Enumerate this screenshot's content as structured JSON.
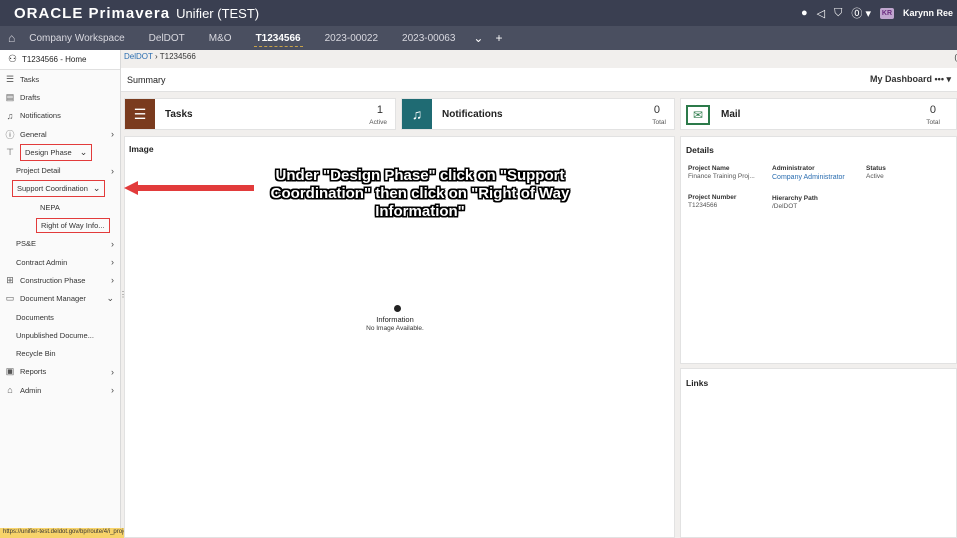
{
  "app": {
    "logo": "ORACLE Primavera",
    "title": "Unifier (TEST)",
    "user_initials": "KR",
    "user_name": "Karynn Ree"
  },
  "tabs": [
    "Company Workspace",
    "DelDOT",
    "M&O",
    "T1234566",
    "2023-00022",
    "2023-00063"
  ],
  "active_tab": "T1234566",
  "sidebar": {
    "home": "T1234566 - Home",
    "items": [
      {
        "label": "Tasks",
        "icon": "tasks-icon"
      },
      {
        "label": "Drafts",
        "icon": "drafts-icon"
      },
      {
        "label": "Notifications",
        "icon": "bell-icon"
      },
      {
        "label": "General",
        "icon": "info-icon"
      },
      {
        "label": "Design Phase",
        "icon": "design-icon"
      },
      {
        "label": "Project Detail"
      },
      {
        "label": "Support Coordination"
      },
      {
        "label": "NEPA"
      },
      {
        "label": "Right of Way Info..."
      },
      {
        "label": "PS&E"
      },
      {
        "label": "Contract Admin"
      },
      {
        "label": "Construction Phase",
        "icon": "construction-icon"
      },
      {
        "label": "Document Manager",
        "icon": "folder-icon"
      },
      {
        "label": "Documents"
      },
      {
        "label": "Unpublished Docume..."
      },
      {
        "label": "Recycle Bin"
      },
      {
        "label": "Reports",
        "icon": "reports-icon"
      },
      {
        "label": "Admin",
        "icon": "admin-icon"
      }
    ]
  },
  "status_url": "https://unifier-test.deldot.gov/bp/route/4/i_projectname?__uref=uuu932108827#",
  "breadcrumb": {
    "root": "DelDOT",
    "current": "T1234566"
  },
  "summary_label": "Summary",
  "dashboard_label": "My Dashboard",
  "tiles": {
    "tasks": {
      "title": "Tasks",
      "count": "1",
      "sub": "Active",
      "color": "#7a3b1e"
    },
    "notifications": {
      "title": "Notifications",
      "count": "0",
      "sub": "Total",
      "color": "#1f6b73"
    },
    "mail": {
      "title": "Mail",
      "count": "0",
      "sub": "Total",
      "color": "#2c7a4a"
    }
  },
  "image_section": {
    "title": "Image",
    "info_title": "Information",
    "info_sub": "No Image Available."
  },
  "details": {
    "title": "Details",
    "project_name_label": "Project Name",
    "project_name": "Finance Training Proj...",
    "administrator_label": "Administrator",
    "administrator": "Company Administrator",
    "status_label": "Status",
    "status": "Active",
    "project_number_label": "Project Number",
    "project_number": "T1234566",
    "hierarchy_label": "Hierarchy Path",
    "hierarchy": "/DelDOT"
  },
  "links_title": "Links",
  "annotation": "Under \"Design Phase\" click on \"Support Coordination\" then click on \"Right of Way Information\"",
  "colors": {
    "appbar": "#3a3f51",
    "tabbar": "#4a4f60",
    "highlight": "#e23b3b"
  }
}
